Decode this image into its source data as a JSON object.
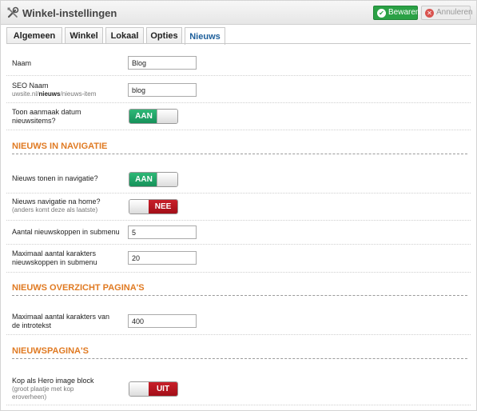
{
  "header": {
    "title": "Winkel-instellingen",
    "icon": "tools-icon",
    "save_label": "Bewaren",
    "cancel_label": "Annuleren"
  },
  "tabs": [
    {
      "label": "Algemeen",
      "active": false
    },
    {
      "label": "Winkel",
      "active": false
    },
    {
      "label": "Lokaal",
      "active": false
    },
    {
      "label": "Opties",
      "active": false
    },
    {
      "label": "Nieuws",
      "active": true
    }
  ],
  "fields": {
    "naam": {
      "label": "Naam",
      "value": "Blog"
    },
    "seo": {
      "label": "SEO Naam",
      "hint_prefix": "uwsite.nl/",
      "hint_bold": "nieuws",
      "hint_suffix": "/nieuws-item",
      "value": "blog"
    },
    "datum": {
      "label": "Toon aanmaak datum nieuwsitems?",
      "state": "AAN"
    }
  },
  "sections": {
    "navigatie": "NIEUWS IN NAVIGATIE",
    "overzicht": "NIEUWS OVERZICHT PAGINA'S",
    "paginas": "NIEUWSPAGINA'S"
  },
  "navigatie": {
    "tonen": {
      "label": "Nieuws tonen in navigatie?",
      "state": "AAN"
    },
    "home": {
      "label": "Nieuws navigatie na home?",
      "sub": "(anders komt deze als laatste)",
      "state": "NEE"
    },
    "aantal": {
      "label": "Aantal nieuwskoppen in submenu",
      "value": "5"
    },
    "karakters": {
      "label": "Maximaal aantal karakters nieuwskoppen in submenu",
      "value": "20"
    }
  },
  "overzicht": {
    "intro": {
      "label": "Maximaal aantal karakters van de introtekst",
      "value": "400"
    }
  },
  "paginas": {
    "hero": {
      "label": "Kop als Hero image block",
      "sub": "(groot plaatje met kop eroverheen)",
      "state": "UIT"
    }
  },
  "colors": {
    "section": "#e07a22",
    "toggle_on": "#16915a",
    "toggle_off": "#a30f18",
    "save": "#2aa145",
    "active_tab": "#1d5f9b"
  }
}
